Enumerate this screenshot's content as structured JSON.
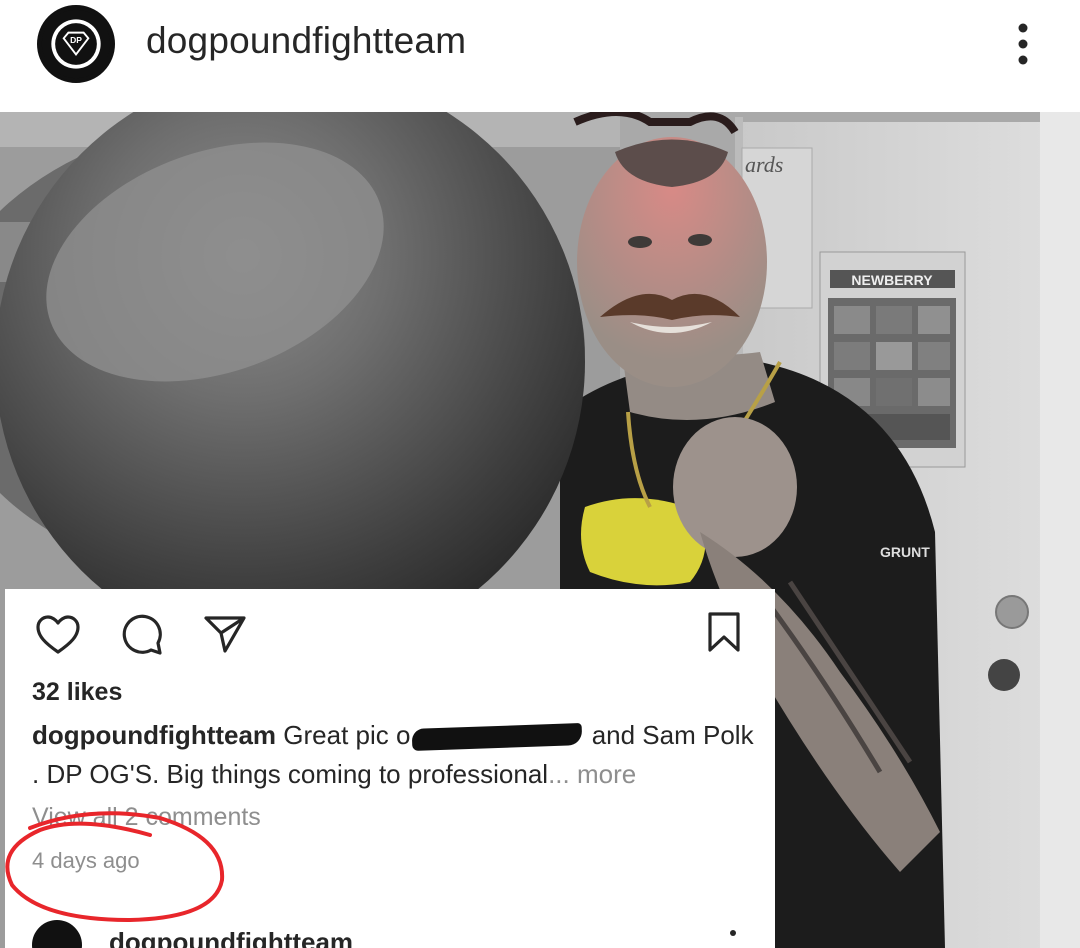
{
  "header": {
    "username": "dogpoundfightteam",
    "avatar_icon": "dp-logo-icon",
    "more_icon": "more-vertical-icon"
  },
  "photo": {
    "poster_header": "NEWBERRY",
    "sign_text": "ards",
    "sleeve_text": "GRUNT"
  },
  "post": {
    "actions": {
      "like_icon": "heart-icon",
      "comment_icon": "comment-icon",
      "share_icon": "send-icon",
      "save_icon": "bookmark-icon"
    },
    "likes": "32 likes",
    "caption": {
      "username": "dogpoundfightteam",
      "text_before": "Great pic o",
      "text_after": "and Sam Polk . DP OG'S. Big things coming to professional",
      "more": "... more"
    },
    "view_comments": "View all 2 comments",
    "timestamp": "4 days ago",
    "next_post_username": "dogpoundfightteam"
  },
  "colors": {
    "annotation_red": "#e8262b",
    "text_primary": "#262626",
    "text_secondary": "#8e8e8e"
  }
}
